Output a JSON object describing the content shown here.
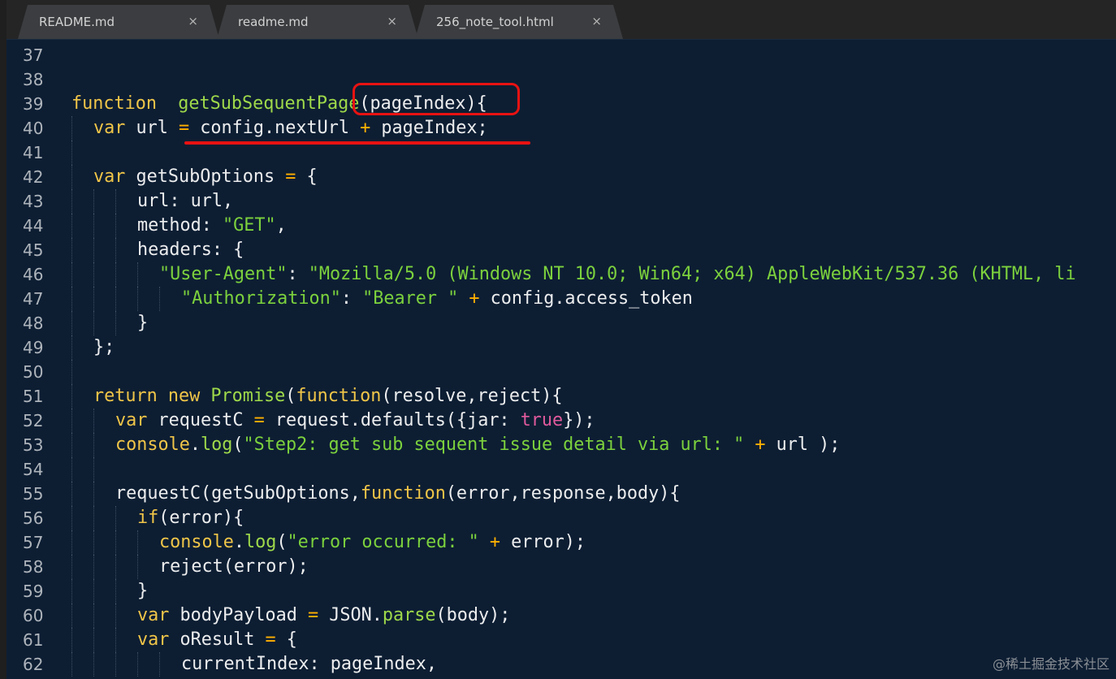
{
  "tabs": [
    {
      "label": "README.md",
      "close": "×"
    },
    {
      "label": "readme.md",
      "close": "×"
    },
    {
      "label": "256_note_tool.html",
      "close": "×"
    }
  ],
  "lines": [
    {
      "n": "37",
      "indent": 0,
      "tokens": []
    },
    {
      "n": "38",
      "indent": 0,
      "tokens": []
    },
    {
      "n": "39",
      "indent": 0,
      "tokens": [
        [
          "kw",
          "function"
        ],
        [
          "",
          "  "
        ],
        [
          "fn",
          "getSubSequentPage"
        ],
        [
          "",
          "(pageIndex){"
        ]
      ]
    },
    {
      "n": "40",
      "indent": 1,
      "tokens": [
        [
          "kw",
          "var"
        ],
        [
          "",
          " url "
        ],
        [
          "op",
          "="
        ],
        [
          "",
          " config.nextUrl "
        ],
        [
          "op",
          "+"
        ],
        [
          "",
          " pageIndex;"
        ]
      ]
    },
    {
      "n": "41",
      "indent": 1,
      "tokens": []
    },
    {
      "n": "42",
      "indent": 1,
      "tokens": [
        [
          "kw",
          "var"
        ],
        [
          "",
          " getSubOptions "
        ],
        [
          "op",
          "="
        ],
        [
          "",
          " {"
        ]
      ]
    },
    {
      "n": "43",
      "indent": 3,
      "tokens": [
        [
          "",
          "url: url,"
        ]
      ]
    },
    {
      "n": "44",
      "indent": 3,
      "tokens": [
        [
          "",
          "method: "
        ],
        [
          "str",
          "\"GET\""
        ],
        [
          "",
          ","
        ]
      ]
    },
    {
      "n": "45",
      "indent": 3,
      "tokens": [
        [
          "",
          "headers: {"
        ]
      ]
    },
    {
      "n": "46",
      "indent": 4,
      "tokens": [
        [
          "str",
          "\"User-Agent\""
        ],
        [
          "",
          ": "
        ],
        [
          "str",
          "\"Mozilla/5.0 (Windows NT 10.0; Win64; x64) AppleWebKit/537.36 (KHTML, li"
        ]
      ]
    },
    {
      "n": "47",
      "indent": 5,
      "tokens": [
        [
          "str",
          "\"Authorization\""
        ],
        [
          "",
          ": "
        ],
        [
          "str",
          "\"Bearer \""
        ],
        [
          "",
          " "
        ],
        [
          "op",
          "+"
        ],
        [
          "",
          " config.access_token"
        ]
      ]
    },
    {
      "n": "48",
      "indent": 3,
      "tokens": [
        [
          "",
          "}"
        ]
      ]
    },
    {
      "n": "49",
      "indent": 1,
      "tokens": [
        [
          "",
          "};"
        ]
      ]
    },
    {
      "n": "50",
      "indent": 1,
      "tokens": []
    },
    {
      "n": "51",
      "indent": 1,
      "tokens": [
        [
          "kw",
          "return"
        ],
        [
          "",
          " "
        ],
        [
          "kw",
          "new"
        ],
        [
          "",
          " "
        ],
        [
          "fn",
          "Promise"
        ],
        [
          "",
          "("
        ],
        [
          "kw",
          "function"
        ],
        [
          "",
          "(resolve,reject){"
        ]
      ]
    },
    {
      "n": "52",
      "indent": 2,
      "tokens": [
        [
          "kw",
          "var"
        ],
        [
          "",
          " requestC "
        ],
        [
          "op",
          "="
        ],
        [
          "",
          " request.defaults({jar: "
        ],
        [
          "bool",
          "true"
        ],
        [
          "",
          "});"
        ]
      ]
    },
    {
      "n": "53",
      "indent": 2,
      "tokens": [
        [
          "kw",
          "console"
        ],
        [
          "",
          "."
        ],
        [
          "fn",
          "log"
        ],
        [
          "",
          "("
        ],
        [
          "str",
          "\"Step2: get sub sequent issue detail via url: \""
        ],
        [
          "",
          " "
        ],
        [
          "op",
          "+"
        ],
        [
          "",
          " url );"
        ]
      ]
    },
    {
      "n": "54",
      "indent": 2,
      "tokens": []
    },
    {
      "n": "55",
      "indent": 2,
      "tokens": [
        [
          "",
          "requestC(getSubOptions,"
        ],
        [
          "kw",
          "function"
        ],
        [
          "",
          "(error,response,body){"
        ]
      ]
    },
    {
      "n": "56",
      "indent": 3,
      "tokens": [
        [
          "kw",
          "if"
        ],
        [
          "",
          "(error){"
        ]
      ]
    },
    {
      "n": "57",
      "indent": 4,
      "tokens": [
        [
          "kw",
          "console"
        ],
        [
          "",
          "."
        ],
        [
          "fn",
          "log"
        ],
        [
          "",
          "("
        ],
        [
          "str",
          "\"error occurred: \""
        ],
        [
          "",
          " "
        ],
        [
          "op",
          "+"
        ],
        [
          "",
          " error);"
        ]
      ]
    },
    {
      "n": "58",
      "indent": 4,
      "tokens": [
        [
          "",
          "reject(error);"
        ]
      ]
    },
    {
      "n": "59",
      "indent": 3,
      "tokens": [
        [
          "",
          "}"
        ]
      ]
    },
    {
      "n": "60",
      "indent": 3,
      "tokens": [
        [
          "kw",
          "var"
        ],
        [
          "",
          " bodyPayload "
        ],
        [
          "op",
          "="
        ],
        [
          "",
          " JSON."
        ],
        [
          "fn",
          "parse"
        ],
        [
          "",
          "(body);"
        ]
      ]
    },
    {
      "n": "61",
      "indent": 3,
      "tokens": [
        [
          "kw",
          "var"
        ],
        [
          "",
          " oResult "
        ],
        [
          "op",
          "="
        ],
        [
          "",
          " {"
        ]
      ]
    },
    {
      "n": "62",
      "indent": 5,
      "tokens": [
        [
          "",
          "currentIndex: pageIndex,"
        ]
      ]
    }
  ],
  "watermark": "@稀土掘金技术社区"
}
